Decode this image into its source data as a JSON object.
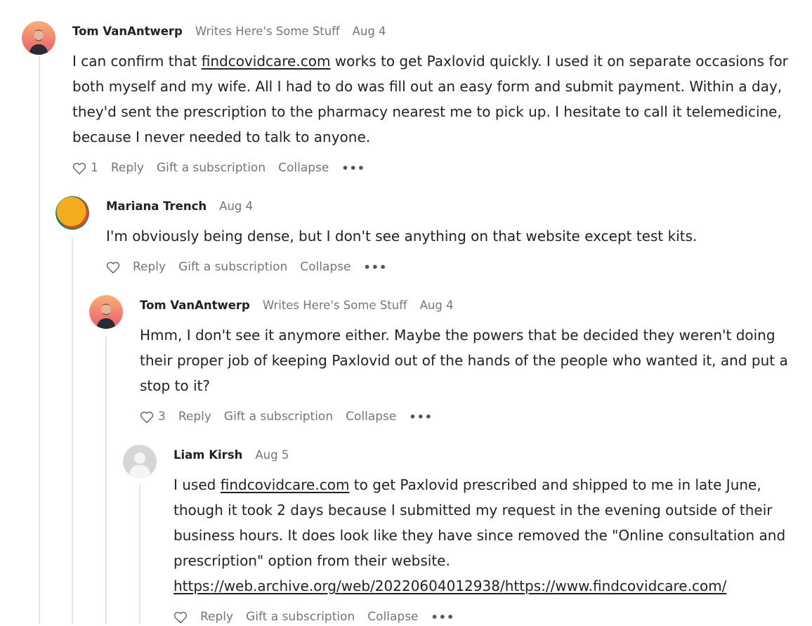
{
  "comments": [
    {
      "author": "Tom VanAntwerp",
      "byline": "Writes Here's Some Stuff",
      "date": "Aug 4",
      "text_before": "I can confirm that ",
      "link": "findcovidcare.com",
      "text_after": " works to get Paxlovid quickly. I used it on separate occasions for both myself and my wife. All I had to do was fill out an easy form and submit payment. Within a day, they'd sent the prescription to the pharmacy nearest me to pick up. I hesitate to call it telemedicine, because I never needed to talk to anyone.",
      "likes": "1"
    },
    {
      "author": "Mariana Trench",
      "date": "Aug 4",
      "text": "I'm obviously being dense, but I don't see anything on that website except test kits.",
      "likes": ""
    },
    {
      "author": "Tom VanAntwerp",
      "byline": "Writes Here's Some Stuff",
      "date": "Aug 4",
      "text": "Hmm, I don't see it anymore either. Maybe the powers that be decided they weren't doing their proper job of keeping Paxlovid out of the hands of the people who wanted it, and put a stop to it?",
      "likes": "3"
    },
    {
      "author": "Liam Kirsh",
      "date": "Aug 5",
      "text_before": "I used ",
      "link": "findcovidcare.com",
      "text_after": " to get Paxlovid prescribed and shipped to me in late June, though it took 2 days because I submitted my request in the evening outside of their business hours. It does look like they have since removed the \"Online consultation and prescription\" option from their website.",
      "url": "https://web.archive.org/web/20220604012938/https://www.findcovidcare.com/",
      "likes": ""
    }
  ],
  "actions": {
    "reply": "Reply",
    "gift": "Gift a subscription",
    "collapse": "Collapse",
    "more": "•••"
  },
  "icons": {
    "like": "heart-icon",
    "more": "more-options-icon"
  },
  "colors": {
    "text": "#222222",
    "muted": "#777777",
    "thread_line": "#e5e5e5"
  }
}
